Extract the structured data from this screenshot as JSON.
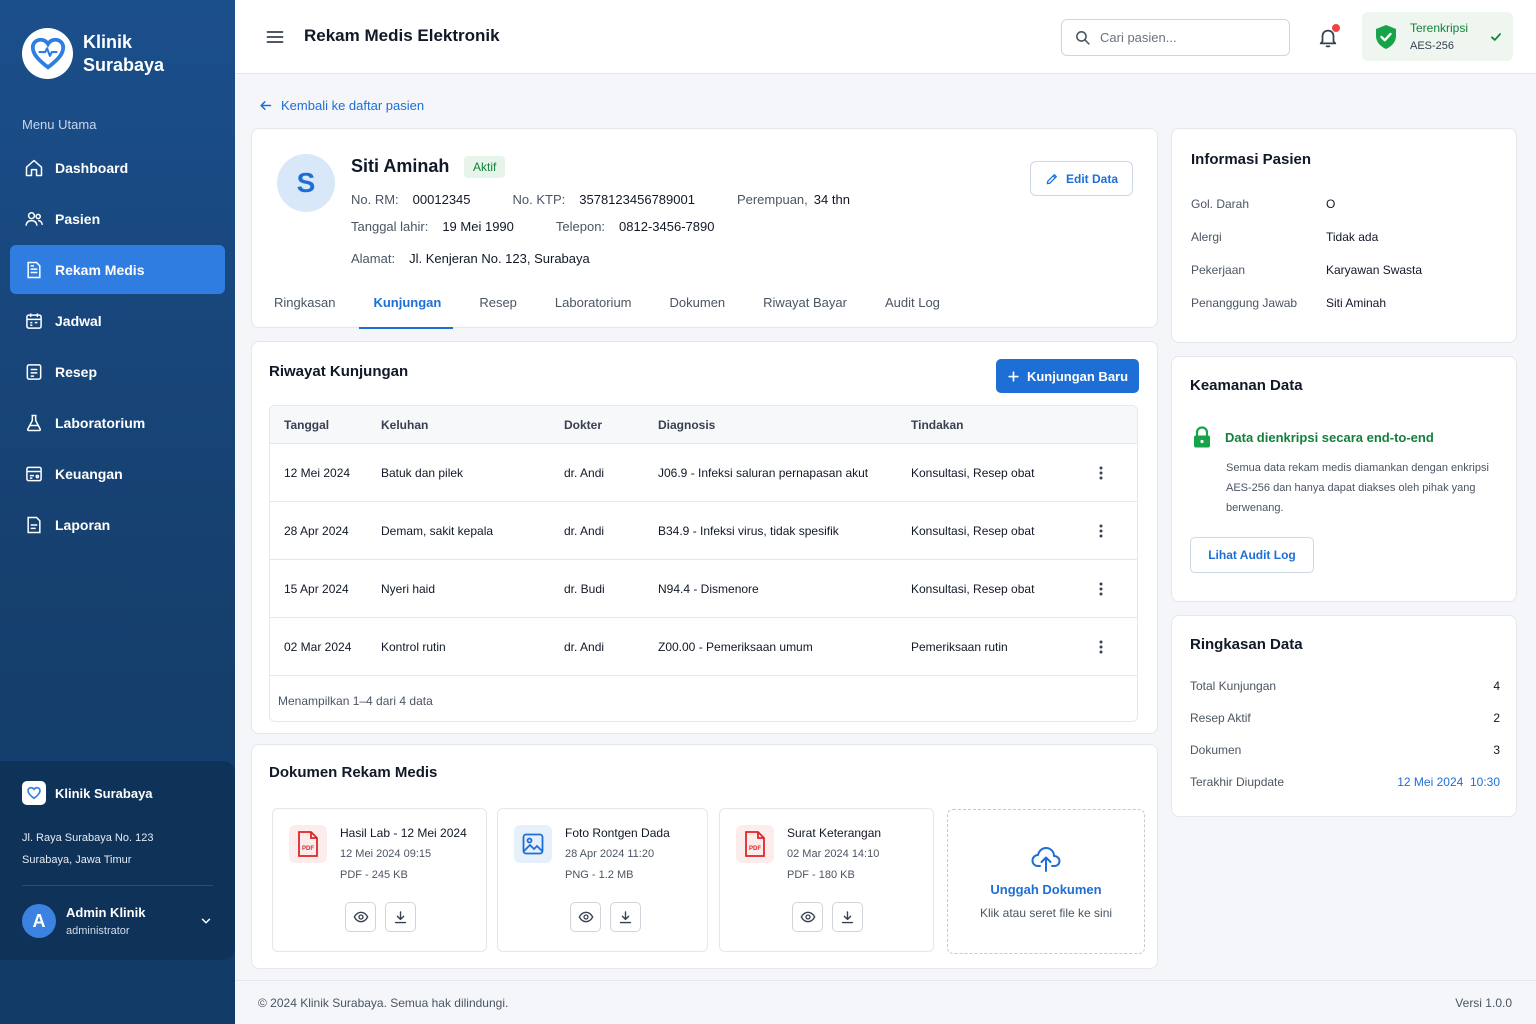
{
  "brand": {
    "name_line1": "Klinik",
    "name_line2": "Surabaya"
  },
  "sidebar": {
    "menu_title": "Menu Utama",
    "items": [
      {
        "label": "Dashboard",
        "icon": "home-icon"
      },
      {
        "label": "Pasien",
        "icon": "users-icon"
      },
      {
        "label": "Rekam Medis",
        "icon": "document-icon",
        "active": true
      },
      {
        "label": "Jadwal",
        "icon": "calendar-icon"
      },
      {
        "label": "Resep",
        "icon": "prescription-icon"
      },
      {
        "label": "Laboratorium",
        "icon": "flask-icon"
      },
      {
        "label": "Keuangan",
        "icon": "wallet-icon"
      },
      {
        "label": "Laporan",
        "icon": "report-icon"
      }
    ],
    "clinic": {
      "name": "Klinik Surabaya",
      "address_line1": "Jl. Raya Surabaya No. 123",
      "address_line2": "Surabaya, Jawa Timur"
    },
    "user": {
      "initial": "A",
      "name": "Admin Klinik",
      "role": "administrator"
    }
  },
  "header": {
    "title": "Rekam Medis Elektronik",
    "search_placeholder": "Cari pasien...",
    "security": {
      "label": "Terenkripsi",
      "detail": "AES-256"
    }
  },
  "back_link": "Kembali ke daftar pasien",
  "patient": {
    "initial": "S",
    "name": "Siti Aminah",
    "status": "Aktif",
    "rm_label": "No. RM:",
    "rm": "00012345",
    "ktp_label": "No. KTP:",
    "ktp": "3578123456789001",
    "gender": "Perempuan,",
    "age": "34 thn",
    "dob_label": "Tanggal lahir:",
    "dob": "19 Mei 1990",
    "phone_label": "Telepon:",
    "phone": "0812-3456-7890",
    "address_label": "Alamat:",
    "address": "Jl. Kenjeran No. 123, Surabaya",
    "edit_label": "Edit Data"
  },
  "tabs": [
    "Ringkasan",
    "Kunjungan",
    "Resep",
    "Laboratorium",
    "Dokumen",
    "Riwayat Bayar",
    "Audit Log"
  ],
  "visits": {
    "title": "Riwayat Kunjungan",
    "new_label": "Kunjungan Baru",
    "columns": [
      "Tanggal",
      "Keluhan",
      "Dokter",
      "Diagnosis",
      "Tindakan"
    ],
    "rows": [
      [
        "12 Mei 2024",
        "Batuk dan pilek",
        "dr. Andi",
        "J06.9 - Infeksi saluran pernapasan akut",
        "Konsultasi, Resep obat"
      ],
      [
        "28 Apr 2024",
        "Demam, sakit kepala",
        "dr. Andi",
        "B34.9 - Infeksi virus, tidak spesifik",
        "Konsultasi, Resep obat"
      ],
      [
        "15 Apr 2024",
        "Nyeri haid",
        "dr. Budi",
        "N94.4 - Dismenore",
        "Konsultasi, Resep obat"
      ],
      [
        "02 Mar 2024",
        "Kontrol rutin",
        "dr. Andi",
        "Z00.00 - Pemeriksaan umum",
        "Pemeriksaan rutin"
      ]
    ],
    "footer": "Menampilkan 1–4 dari 4 data"
  },
  "documents": {
    "title": "Dokumen Rekam Medis",
    "items": [
      {
        "name": "Hasil Lab - 12 Mei 2024",
        "date": "12 Mei 2024 09:15",
        "meta": "PDF - 245 KB",
        "icon": "pdf-file-icon"
      },
      {
        "name": "Foto Rontgen Dada",
        "date": "28 Apr 2024 11:20",
        "meta": "PNG - 1.2 MB",
        "icon": "image-file-icon"
      },
      {
        "name": "Surat Keterangan",
        "date": "02 Mar 2024 14:10",
        "meta": "PDF - 180 KB",
        "icon": "pdf-file-icon"
      }
    ],
    "upload_title": "Unggah Dokumen",
    "upload_sub": "Klik atau seret file ke sini"
  },
  "info": {
    "title": "Informasi Pasien",
    "rows": [
      {
        "k": "Gol. Darah",
        "v": "O"
      },
      {
        "k": "Alergi",
        "v": "Tidak ada"
      },
      {
        "k": "Pekerjaan",
        "v": "Karyawan Swasta"
      },
      {
        "k": "Penanggung Jawab",
        "v": "Siti Aminah"
      }
    ]
  },
  "security_card": {
    "title": "Keamanan Data",
    "headline": "Data dienkripsi secara end-to-end",
    "body": "Semua data rekam medis diamankan dengan enkripsi AES-256 dan hanya dapat diakses oleh pihak yang berwenang.",
    "button": "Lihat Audit Log"
  },
  "summary": {
    "title": "Ringkasan Data",
    "rows": [
      {
        "k": "Total Kunjungan",
        "v": "4"
      },
      {
        "k": "Resep Aktif",
        "v": "2"
      },
      {
        "k": "Dokumen",
        "v": "3"
      },
      {
        "k": "Terakhir Diupdate",
        "v": "12 Mei 2024  10:30"
      }
    ]
  },
  "footer": {
    "copyright": "© 2024 Klinik Surabaya. Semua hak dilindungi.",
    "version": "Versi 1.0.0"
  },
  "colors": {
    "primary": "#1d6fd6",
    "sidebar": "#1b4f8c",
    "success": "#15803d",
    "danger": "#ef4444"
  }
}
